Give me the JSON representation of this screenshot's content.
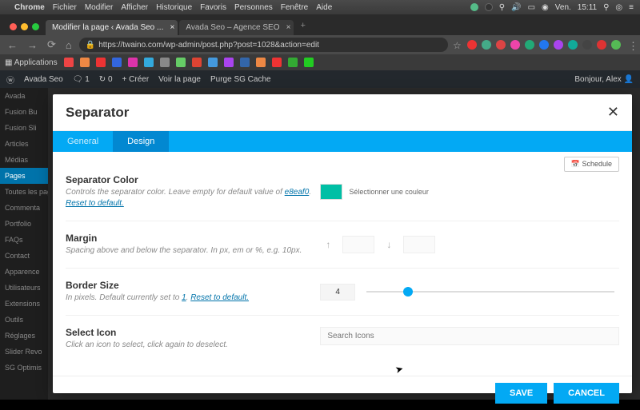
{
  "menubar": {
    "app": "Chrome",
    "items": [
      "Fichier",
      "Modifier",
      "Afficher",
      "Historique",
      "Favoris",
      "Personnes",
      "Fenêtre",
      "Aide"
    ],
    "day": "Ven.",
    "time": "15:11"
  },
  "tabs": [
    {
      "label": "Modifier la page ‹ Avada Seo ...",
      "active": true
    },
    {
      "label": "Avada Seo – Agence SEO",
      "active": false
    }
  ],
  "url": "https://twaino.com/wp-admin/post.php?post=1028&action=edit",
  "bookmarks_label": "Applications",
  "wpbar": {
    "site": "Avada Seo",
    "comments": "1",
    "updates": "0",
    "new": "+ Créer",
    "view": "Voir la page",
    "purge": "Purge SG Cache",
    "greeting": "Bonjour, Alex"
  },
  "sidebar": [
    "Avada",
    "Fusion Bu",
    "Fusion Sli",
    "Articles",
    "Médias",
    "Pages",
    "Toutes les pag",
    "Commenta",
    "Portfolio",
    "FAQs",
    "Contact",
    "Apparence",
    "Utilisateurs",
    "Extensions",
    "Outils",
    "Réglages",
    "Slider Revo",
    "SG Optimis"
  ],
  "sidebar_active_index": 5,
  "modal": {
    "title": "Separator",
    "tabs": [
      "General",
      "Design"
    ],
    "active_tab": 1,
    "schedule_btn": "Schedule",
    "sections": {
      "sep_color": {
        "label": "Separator Color",
        "desc_prefix": "Controls the separator color. Leave empty for default value of ",
        "default_value": "e8eaf0",
        "reset": "Reset to default.",
        "picker_label": "Sélectionner une couleur",
        "swatch_color": "#00bfa5"
      },
      "margin": {
        "label": "Margin",
        "desc": "Spacing above and below the separator. In px, em or %, e.g. 10px."
      },
      "border": {
        "label": "Border Size",
        "desc_prefix": "In pixels. Default currently set to ",
        "default_value": "1",
        "reset": "Reset to default.",
        "value": "4",
        "slider_percent": 15
      },
      "icon": {
        "label": "Select Icon",
        "desc": "Click an icon to select, click again to deselect.",
        "placeholder": "Search Icons"
      }
    },
    "save": "SAVE",
    "cancel": "CANCEL"
  }
}
